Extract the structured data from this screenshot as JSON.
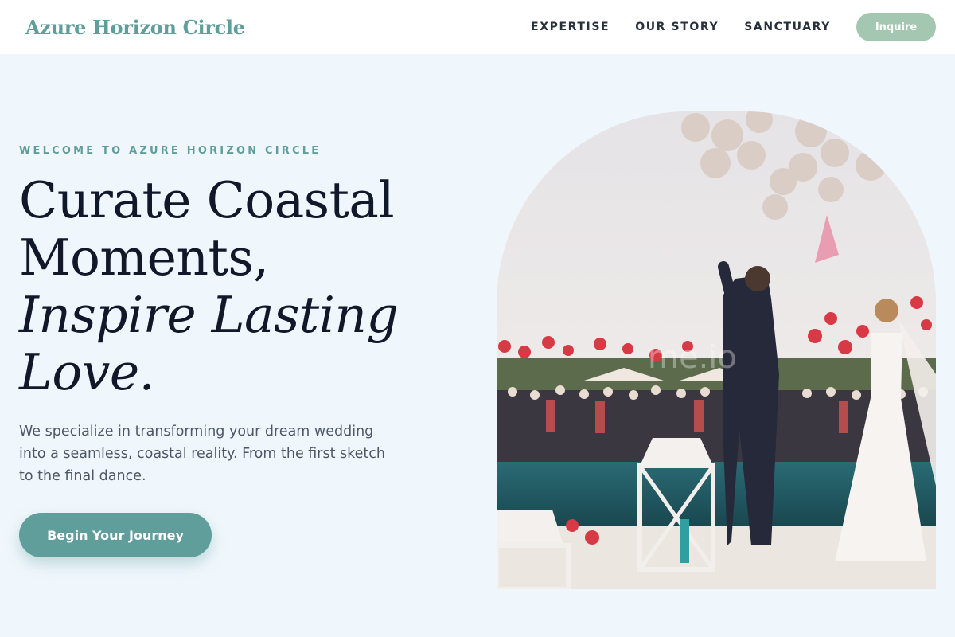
{
  "header": {
    "brand": "Azure Horizon Circle",
    "nav": [
      "EXPERTISE",
      "OUR STORY",
      "SANCTUARY"
    ],
    "inquire_label": "Inquire"
  },
  "hero": {
    "eyebrow": "WELCOME TO AZURE HORIZON CIRCLE",
    "headline_line1": "Curate Coastal",
    "headline_line2": "Moments,",
    "headline_italic1": "Inspire Lasting",
    "headline_italic2": "Love.",
    "description": "We specialize in transforming your dream wedding into a seamless, coastal reality. From the first sketch to the final dance.",
    "cta_label": "Begin Your Journey",
    "photo_watermark": "me.io"
  },
  "colors": {
    "brand_teal": "#5f9e9b",
    "inquire_green": "#a3c7b0",
    "page_background": "#f0f7fc",
    "heading_navy": "#10182a"
  }
}
